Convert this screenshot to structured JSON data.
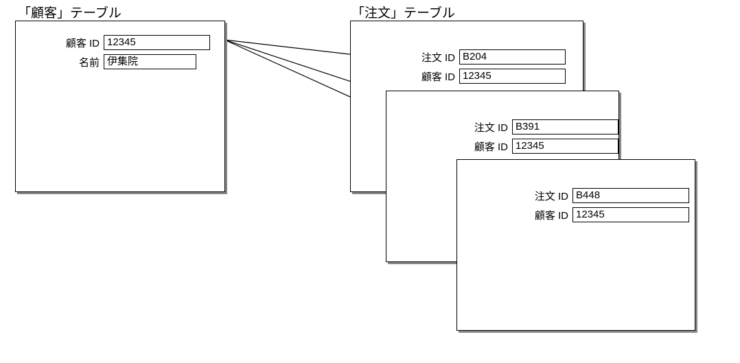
{
  "customer": {
    "title": "「顧客」テーブル",
    "fields": {
      "customer_id_label": "顧客 ID",
      "customer_id_value": "12345",
      "name_label": "名前",
      "name_value": "伊集院"
    }
  },
  "orders": {
    "title": "「注文」テーブル",
    "cards": [
      {
        "order_id_label": "注文 ID",
        "order_id_value": "B204",
        "customer_id_label": "顧客 ID",
        "customer_id_value": "12345"
      },
      {
        "order_id_label": "注文 ID",
        "order_id_value": "B391",
        "customer_id_label": "顧客 ID",
        "customer_id_value": "12345"
      },
      {
        "order_id_label": "注文 ID",
        "order_id_value": "B448",
        "customer_id_label": "顧客 ID",
        "customer_id_value": "12345"
      }
    ]
  }
}
